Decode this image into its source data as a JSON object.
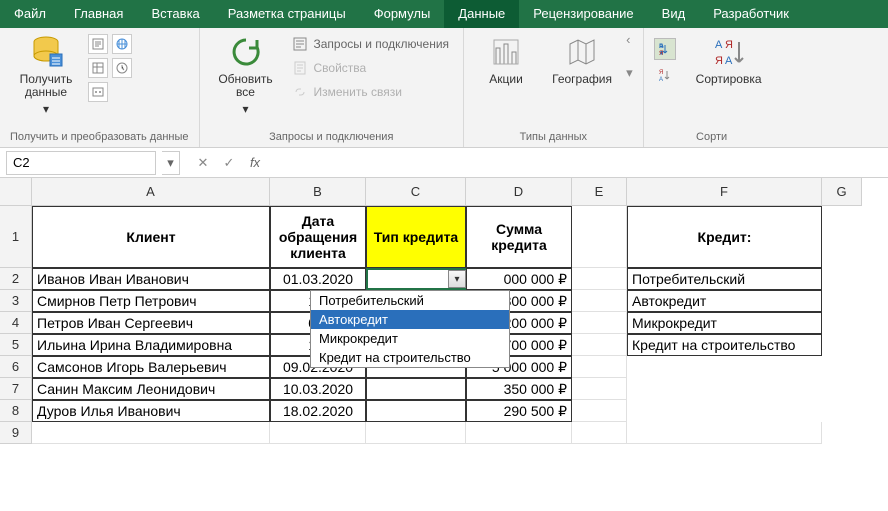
{
  "menu": {
    "tabs": [
      "Файл",
      "Главная",
      "Вставка",
      "Разметка страницы",
      "Формулы",
      "Данные",
      "Рецензирование",
      "Вид",
      "Разработчик"
    ],
    "active": 5
  },
  "ribbon": {
    "groups": {
      "get": {
        "label": "Получить и преобразовать данные",
        "main": "Получить\nданные"
      },
      "queries": {
        "label": "Запросы и подключения",
        "refresh": "Обновить\nвсе",
        "links": [
          "Запросы и подключения",
          "Свойства",
          "Изменить связи"
        ]
      },
      "types": {
        "label": "Типы данных",
        "stocks": "Акции",
        "geo": "География"
      },
      "sort": {
        "label": "Сорти",
        "btn": "Сортировка"
      }
    }
  },
  "formulabar": {
    "namebox": "C2",
    "formula": ""
  },
  "columns": {
    "letters": [
      "A",
      "B",
      "C",
      "D",
      "E",
      "F",
      "G"
    ],
    "widths": [
      238,
      96,
      100,
      106,
      55,
      195,
      40
    ]
  },
  "rows": {
    "heights": [
      62,
      22,
      22,
      22,
      22,
      22,
      22,
      22,
      22
    ],
    "numbers": [
      "1",
      "2",
      "3",
      "4",
      "5",
      "6",
      "7",
      "8",
      "9"
    ]
  },
  "headers": {
    "A": "Клиент",
    "B": "Дата\nобращения\nклиента",
    "C": "Тип кредита",
    "D": "Сумма\nкредита",
    "F": "Кредит:"
  },
  "data": [
    {
      "client": "Иванов Иван Иванович",
      "date": "01.03.2020",
      "type": "",
      "sum": "000 000 ₽"
    },
    {
      "client": "Смирнов Петр Петрович",
      "date": "15.",
      "type": "",
      "sum": "300 000 ₽"
    },
    {
      "client": "Петров Иван Сергеевич",
      "date": "03.",
      "type": "",
      "sum": "200 000 ₽"
    },
    {
      "client": "Ильина Ирина Владимировна",
      "date": "17.",
      "type": "",
      "sum": "700 000 ₽"
    },
    {
      "client": "Самсонов Игорь Валерьевич",
      "date": "09.02.2020",
      "type": "",
      "sum": "5 000 000 ₽"
    },
    {
      "client": "Санин Максим Леонидович",
      "date": "10.03.2020",
      "type": "",
      "sum": "350 000 ₽"
    },
    {
      "client": "Дуров Илья Иванович",
      "date": "18.02.2020",
      "type": "",
      "sum": "290 500 ₽"
    }
  ],
  "credits": [
    "Потребительский",
    "Автокредит",
    "Микрокредит",
    "Кредит на строительство"
  ],
  "dropdown": {
    "options": [
      "Потребительский",
      "Автокредит",
      "Микрокредит",
      "Кредит на строительство"
    ],
    "selected": 1
  },
  "selected_cell": "C2"
}
